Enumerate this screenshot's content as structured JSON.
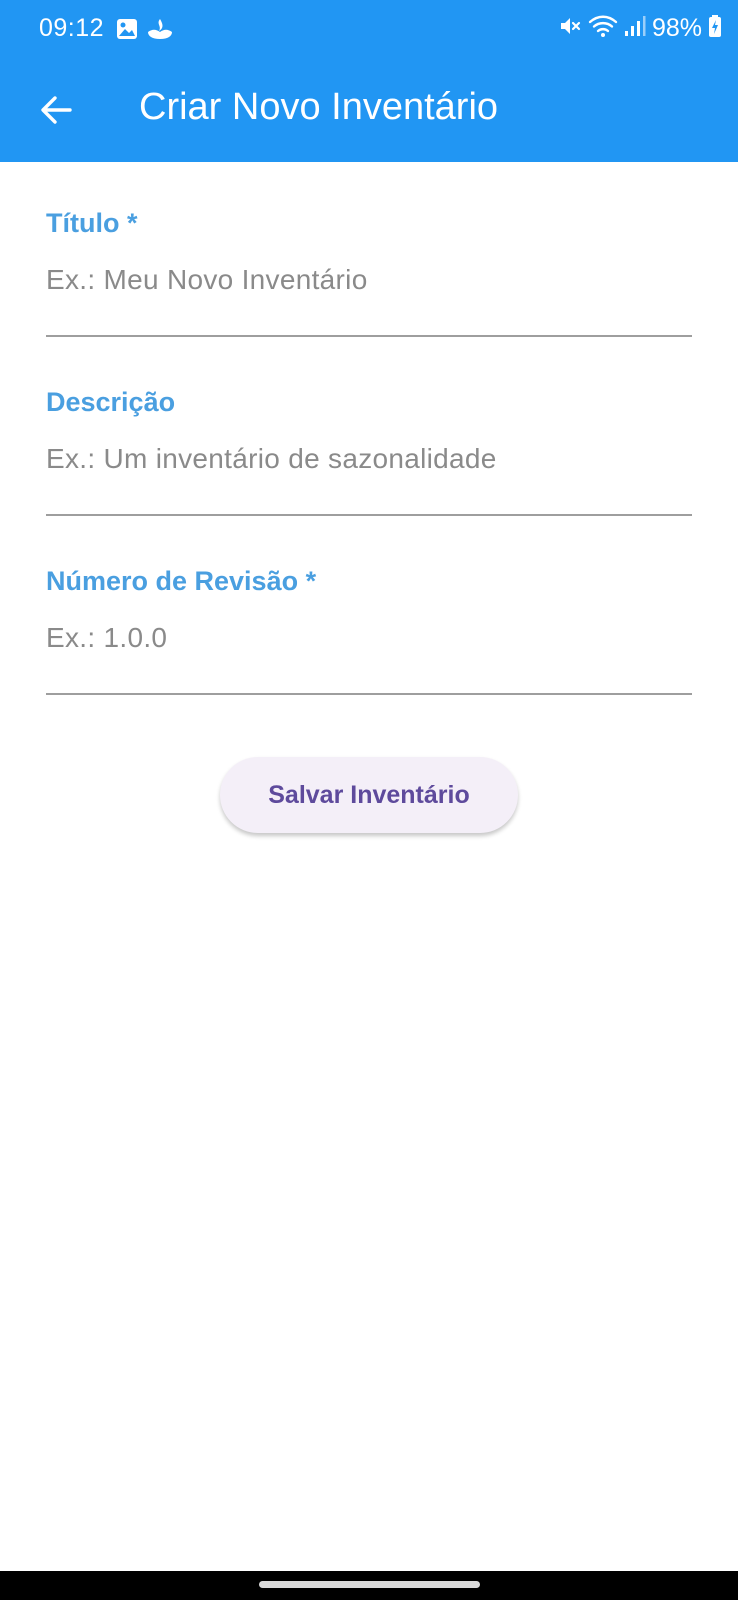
{
  "status_bar": {
    "time": "09:12",
    "battery_text": "98%",
    "left_icons": [
      "image-notification-icon",
      "santander-notification-icon"
    ],
    "right_icons": [
      "mute-icon",
      "wifi-icon",
      "signal-icon",
      "battery-charging-icon"
    ]
  },
  "app_bar": {
    "title": "Criar Novo Inventário",
    "back_icon": "arrow-back-icon",
    "color": "#2196F3"
  },
  "form": {
    "fields": [
      {
        "label": "Título *",
        "placeholder": "Ex.: Meu Novo Inventário",
        "value": ""
      },
      {
        "label": "Descrição",
        "placeholder": "Ex.: Um inventário de sazonalidade",
        "value": ""
      },
      {
        "label": "Número de Revisão *",
        "placeholder": "Ex.: 1.0.0",
        "value": ""
      }
    ],
    "label_color": "#4A9FE0"
  },
  "actions": {
    "save_label": "Salvar Inventário"
  }
}
